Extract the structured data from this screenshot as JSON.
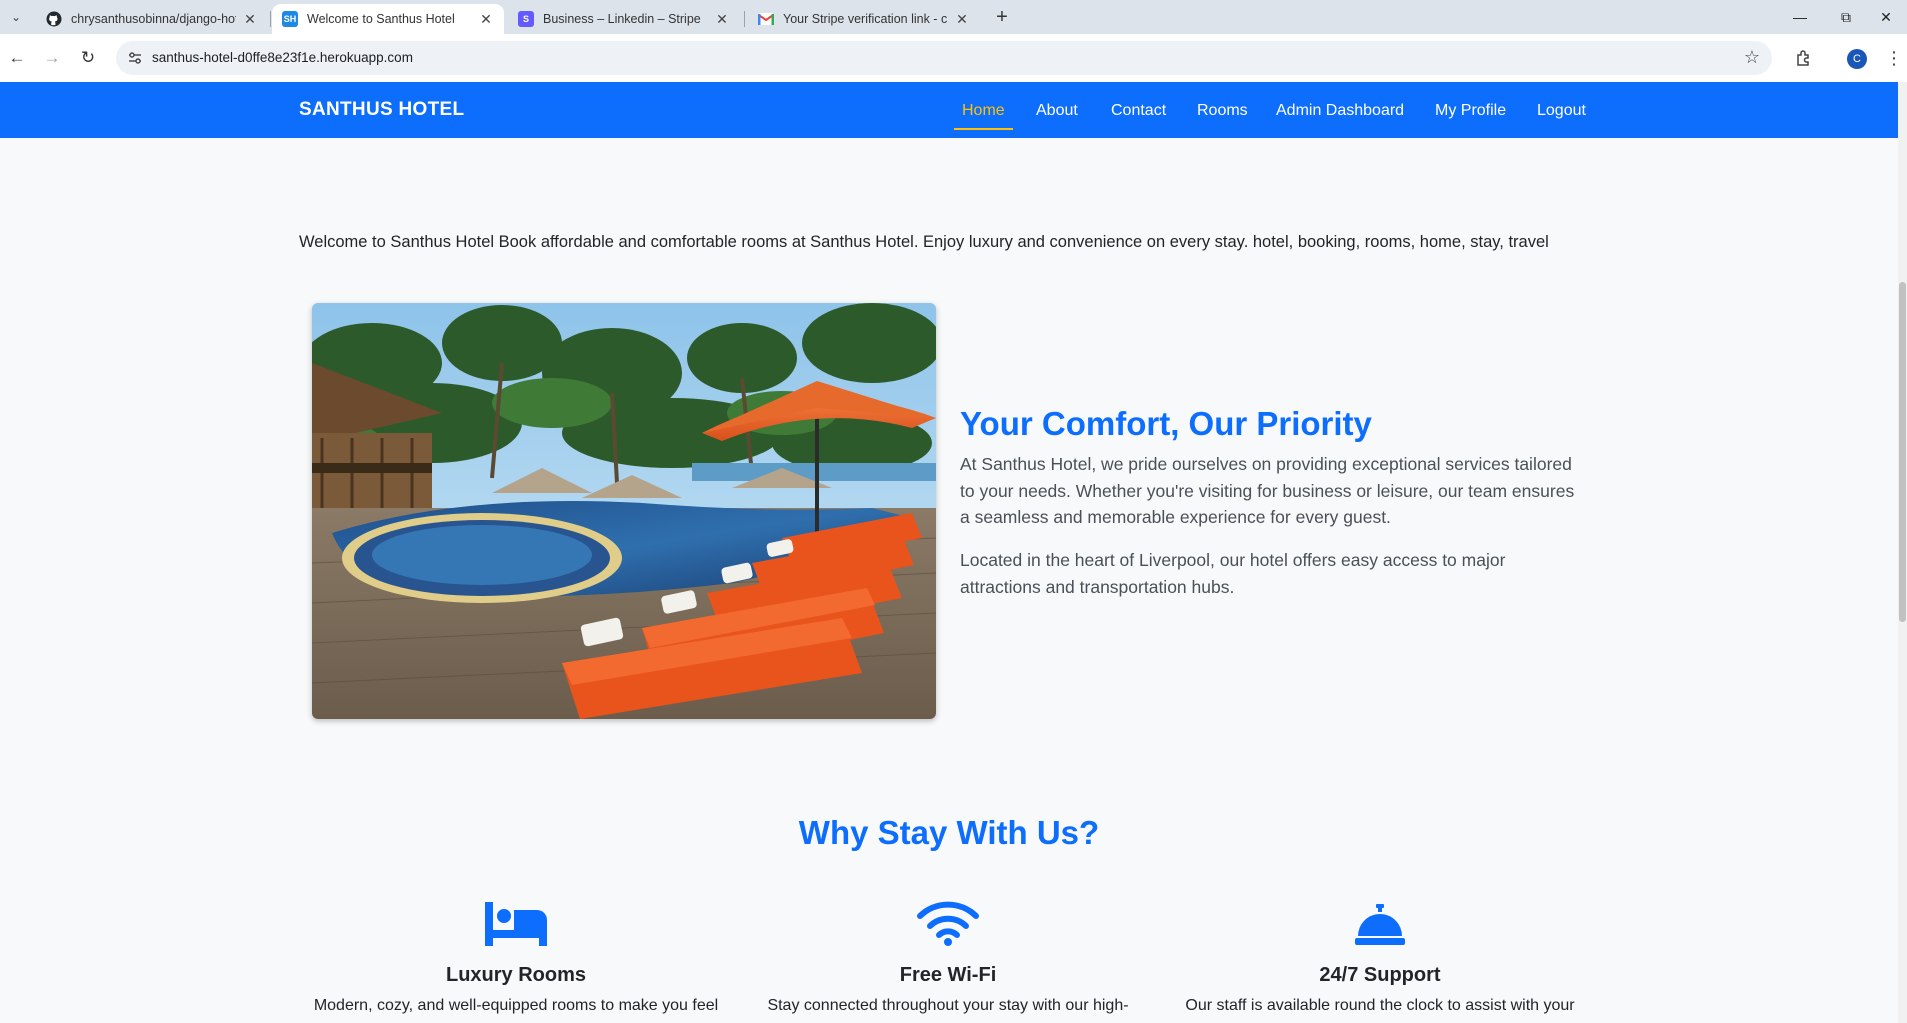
{
  "browser": {
    "tabs": [
      {
        "title": "chrysanthusobinna/django-hot",
        "favicon": "github-icon",
        "active": false
      },
      {
        "title": "Welcome to Santhus Hotel",
        "favicon": "SH",
        "active": true
      },
      {
        "title": "Business – Linkedin – Stripe",
        "favicon": "S",
        "active": false
      },
      {
        "title": "Your Stripe verification link - ch",
        "favicon": "gmail-icon",
        "active": false
      }
    ],
    "url": "santhus-hotel-d0ffe8e23f1e.herokuapp.com",
    "profile_initial": "C"
  },
  "site": {
    "brand": "SANTHUS HOTEL",
    "nav": {
      "home": "Home",
      "about": "About",
      "contact": "Contact",
      "rooms": "Rooms",
      "admin": "Admin Dashboard",
      "profile": "My Profile",
      "logout": "Logout"
    },
    "colors": {
      "primary": "#0d6efd",
      "active_link": "#ffc107",
      "background": "#f8f9fa"
    }
  },
  "intro": "Welcome to Santhus Hotel Book affordable and comfortable rooms at Santhus Hotel. Enjoy luxury and convenience on every stay. hotel, booking, rooms, home, stay, travel",
  "about": {
    "title": "Your Comfort, Our Priority",
    "p1": "At Santhus Hotel, we pride ourselves on providing exceptional services tailored to your needs. Whether you're visiting for business or leisure, our team ensures a seamless and memorable experience for every guest.",
    "p2": "Located in the heart of Liverpool, our hotel offers easy access to major attractions and transportation hubs."
  },
  "why": {
    "title": "Why Stay With Us?",
    "features": [
      {
        "icon": "bed-icon",
        "name": "Luxury Rooms",
        "desc": "Modern, cozy, and well-equipped rooms to make you feel"
      },
      {
        "icon": "wifi-icon",
        "name": "Free Wi-Fi",
        "desc": "Stay connected throughout your stay with our high-"
      },
      {
        "icon": "concierge-bell-icon",
        "name": "24/7 Support",
        "desc": "Our staff is available round the clock to assist with your"
      }
    ]
  }
}
